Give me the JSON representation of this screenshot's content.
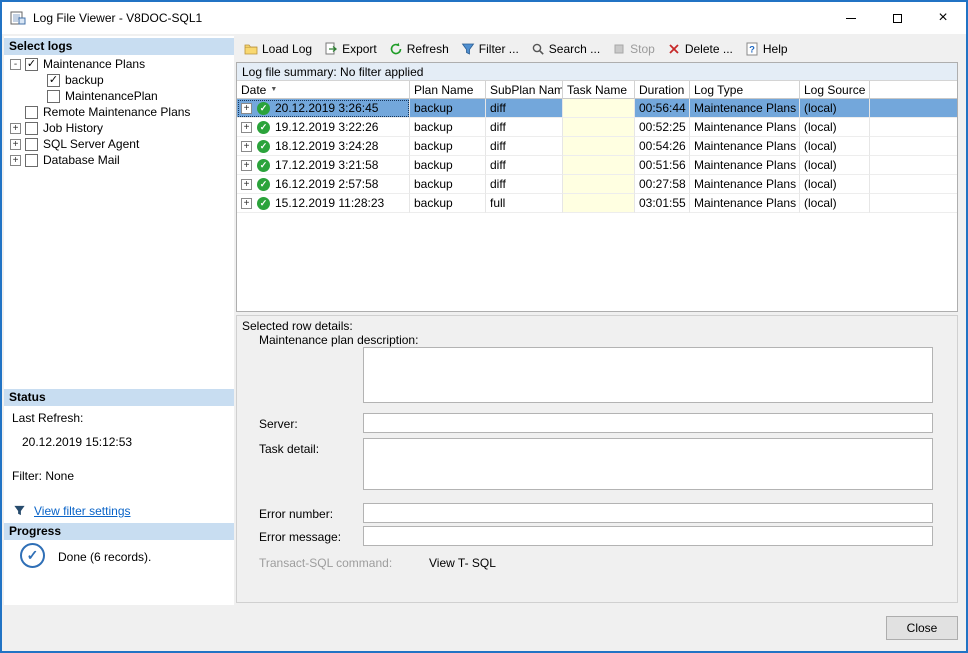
{
  "window": {
    "title": "Log File Viewer - V8DOC-SQL1"
  },
  "toolbar": {
    "items": [
      {
        "id": "load-log",
        "label": "Load Log",
        "icon": "folder",
        "disabled": false
      },
      {
        "id": "export",
        "label": "Export",
        "icon": "export",
        "disabled": false
      },
      {
        "id": "refresh",
        "label": "Refresh",
        "icon": "refresh",
        "disabled": false
      },
      {
        "id": "filter",
        "label": "Filter ...",
        "icon": "filter",
        "disabled": false
      },
      {
        "id": "search",
        "label": "Search ...",
        "icon": "search",
        "disabled": false
      },
      {
        "id": "stop",
        "label": "Stop",
        "icon": "stop",
        "disabled": true
      },
      {
        "id": "delete",
        "label": "Delete ...",
        "icon": "delete",
        "disabled": false
      },
      {
        "id": "help",
        "label": "Help",
        "icon": "help",
        "disabled": false
      }
    ]
  },
  "sidebar": {
    "select_logs_header": "Select logs",
    "tree": [
      {
        "label": "Maintenance Plans",
        "checked": true,
        "expander": "minus",
        "child": false
      },
      {
        "label": "backup",
        "checked": true,
        "expander": null,
        "child": true
      },
      {
        "label": "MaintenancePlan",
        "checked": false,
        "expander": null,
        "child": true
      },
      {
        "label": "Remote Maintenance Plans",
        "checked": false,
        "expander": null,
        "child": false
      },
      {
        "label": "Job History",
        "checked": false,
        "expander": "plus",
        "child": false
      },
      {
        "label": "SQL Server Agent",
        "checked": false,
        "expander": "plus",
        "child": false
      },
      {
        "label": "Database Mail",
        "checked": false,
        "expander": "plus",
        "child": false
      }
    ],
    "status_header": "Status",
    "last_refresh_label": "Last Refresh:",
    "last_refresh_value": "20.12.2019 15:12:53",
    "filter_value": "Filter: None",
    "view_filter_link": "View filter settings",
    "progress_header": "Progress",
    "progress_text": "Done (6 records)."
  },
  "summary": "Log file summary: No filter applied",
  "grid": {
    "columns": [
      "Date",
      "Plan Name",
      "SubPlan Name",
      "Task Name",
      "Duration",
      "Log Type",
      "Log Source"
    ],
    "rows": [
      {
        "date": "20.12.2019 3:26:45",
        "plan_name": "backup",
        "subplan_name": "diff",
        "task_name": "",
        "duration": "00:56:44",
        "log_type": "Maintenance Plans",
        "log_source": "(local)",
        "selected": true
      },
      {
        "date": "19.12.2019 3:22:26",
        "plan_name": "backup",
        "subplan_name": "diff",
        "task_name": "",
        "duration": "00:52:25",
        "log_type": "Maintenance Plans",
        "log_source": "(local)",
        "selected": false
      },
      {
        "date": "18.12.2019 3:24:28",
        "plan_name": "backup",
        "subplan_name": "diff",
        "task_name": "",
        "duration": "00:54:26",
        "log_type": "Maintenance Plans",
        "log_source": "(local)",
        "selected": false
      },
      {
        "date": "17.12.2019 3:21:58",
        "plan_name": "backup",
        "subplan_name": "diff",
        "task_name": "",
        "duration": "00:51:56",
        "log_type": "Maintenance Plans",
        "log_source": "(local)",
        "selected": false
      },
      {
        "date": "16.12.2019 2:57:58",
        "plan_name": "backup",
        "subplan_name": "diff",
        "task_name": "",
        "duration": "00:27:58",
        "log_type": "Maintenance Plans",
        "log_source": "(local)",
        "selected": false
      },
      {
        "date": "15.12.2019 11:28:23",
        "plan_name": "backup",
        "subplan_name": "full",
        "task_name": "",
        "duration": "03:01:55",
        "log_type": "Maintenance Plans",
        "log_source": "(local)",
        "selected": false
      }
    ]
  },
  "details": {
    "header": "Selected row details:",
    "description_label": "Maintenance plan description:",
    "description_value": "",
    "server_label": "Server:",
    "server_value": "",
    "task_detail_label": "Task detail:",
    "task_detail_value": "",
    "error_number_label": "Error number:",
    "error_number_value": "",
    "error_message_label": "Error message:",
    "error_message_value": "",
    "tsql_label": "Transact-SQL command:",
    "view_tsql_label": "View T- SQL"
  },
  "footer": {
    "close_label": "Close"
  },
  "colors": {
    "window_border": "#2173c4",
    "section_header_bg": "#c8ddf1",
    "selected_row_bg": "#73a7db",
    "task_cell_bg": "#ffffe1",
    "summary_bar_bg": "#e4edf6",
    "link": "#0a64c8",
    "status_ok_green": "#2ba33b",
    "delete_red": "#c62828"
  }
}
